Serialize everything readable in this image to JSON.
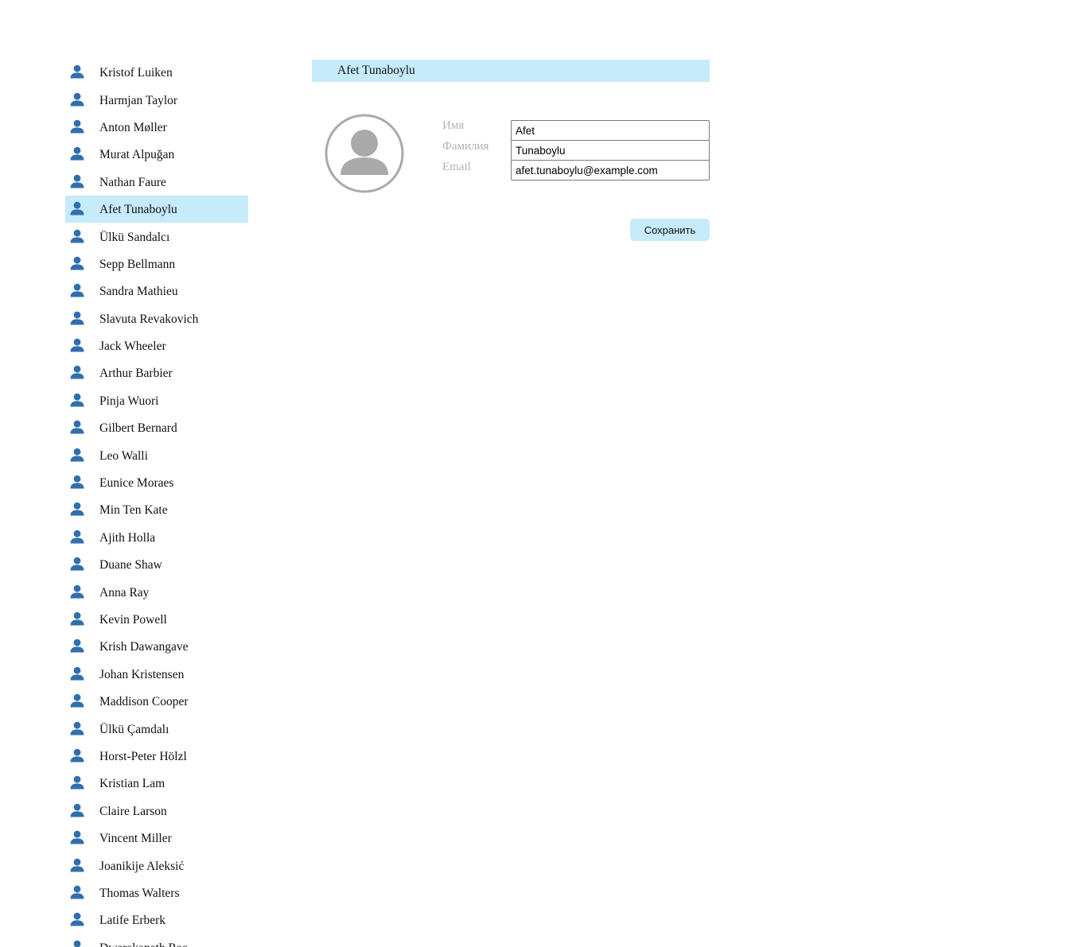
{
  "users": [
    {
      "name": "Kristof Luiken"
    },
    {
      "name": "Harmjan Taylor"
    },
    {
      "name": "Anton Møller"
    },
    {
      "name": "Murat Alpuğan"
    },
    {
      "name": "Nathan Faure"
    },
    {
      "name": "Afet Tunaboylu",
      "selected": true
    },
    {
      "name": "Ülkü Sandalcı"
    },
    {
      "name": "Sepp Bellmann"
    },
    {
      "name": "Sandra Mathieu"
    },
    {
      "name": "Slavuta Revakovich"
    },
    {
      "name": "Jack Wheeler"
    },
    {
      "name": "Arthur Barbier"
    },
    {
      "name": "Pinja Wuori"
    },
    {
      "name": "Gilbert Bernard"
    },
    {
      "name": "Leo Walli"
    },
    {
      "name": "Eunice Moraes"
    },
    {
      "name": "Min Ten Kate"
    },
    {
      "name": "Ajith Holla"
    },
    {
      "name": "Duane Shaw"
    },
    {
      "name": "Anna Ray"
    },
    {
      "name": "Kevin Powell"
    },
    {
      "name": "Krish Dawangave"
    },
    {
      "name": "Johan Kristensen"
    },
    {
      "name": "Maddison Cooper"
    },
    {
      "name": "Ülkü Çamdalı"
    },
    {
      "name": "Horst-Peter Hölzl"
    },
    {
      "name": "Kristian Lam"
    },
    {
      "name": "Claire Larson"
    },
    {
      "name": "Vincent Miller"
    },
    {
      "name": "Joanikije Aleksić"
    },
    {
      "name": "Thomas Walters"
    },
    {
      "name": "Latife Erberk"
    },
    {
      "name": "Dwarakanath Rao"
    }
  ],
  "user_icon": "person-icon",
  "detail": {
    "title": "Afet Tunaboylu",
    "avatar_icon": "avatar-placeholder-icon",
    "first_name_label": "Имя",
    "first_name_value": "Afet",
    "last_name_label": "Фамилия",
    "last_name_value": "Tunaboylu",
    "email_label": "Email",
    "email_value": "afet.tunaboylu@example.com",
    "save_label": "Сохранить"
  },
  "colors": {
    "highlight": "#c6ebfb",
    "icon": "#2f6fad",
    "label": "#b3b3b3",
    "avatar": "#aaaaaa"
  }
}
